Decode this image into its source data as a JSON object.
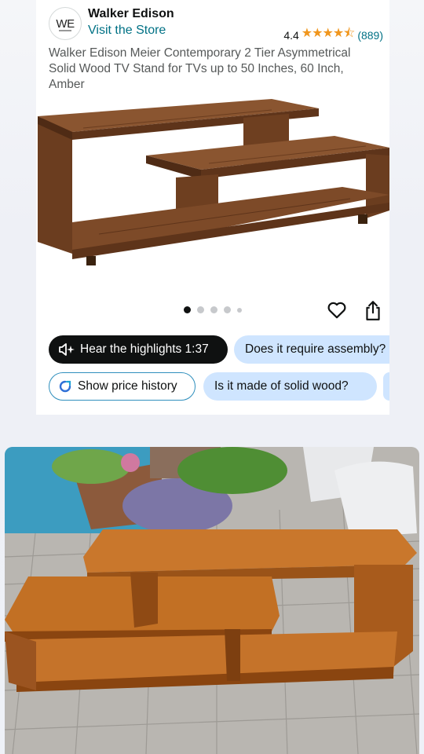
{
  "store": {
    "logo_text": "WE",
    "name": "Walker Edison",
    "link_label": "Visit the Store",
    "rating": "4.4",
    "stars": "★★★★⯪",
    "review_count": "(889)"
  },
  "product": {
    "title": "Walker Edison Meier Contemporary 2 Tier Asymmetrical Solid Wood TV Stand for TVs up to 50 Inches, 60 Inch, Amber",
    "image_count": 5,
    "active_image": 1
  },
  "chips": {
    "highlights": "Hear the highlights 1:37",
    "question_1": "Does it require assembly?",
    "price_history": "Show price history",
    "question_2": "Is it made of solid wood?"
  },
  "icons": {
    "heart": "heart-outline-icon",
    "share": "share-icon",
    "speaker": "speaker-sparkle-icon",
    "price_history": "price-history-icon"
  },
  "colors": {
    "link": "#007185",
    "stars": "#f0961d",
    "chip_blue": "#cfe5ff",
    "chip_dark": "#0f1111",
    "wood": "#7a4a26"
  }
}
